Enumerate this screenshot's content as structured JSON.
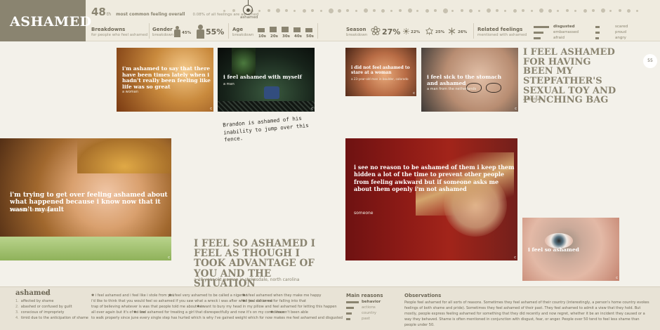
{
  "colors": {
    "accent": "#8a8470",
    "page_bg": "#f3f1ea",
    "topbar_bg": "#efebdf"
  },
  "header": {
    "title": "ASHAMED",
    "rank_number": "48",
    "rank_suffix": "th",
    "rank_label": "most common feeling overall",
    "rank_pct": "0.08% of all feelings are ashamed",
    "marker_label": "ashamed"
  },
  "breakdowns": {
    "title": "Breakdowns",
    "subtitle": "for people who feel ashamed",
    "gender": {
      "title": "Gender",
      "subtitle": "breakdown",
      "female_pct": "45%",
      "male_pct": "55%",
      "female_share": 0.45,
      "male_share": 0.55
    },
    "ages": {
      "title": "Age",
      "subtitle": "breakdown",
      "groups": [
        {
          "label": "10s",
          "share": 0.4
        },
        {
          "label": "20s",
          "share": 0.6
        },
        {
          "label": "30s",
          "share": 0.7
        },
        {
          "label": "40s",
          "share": 0.45
        },
        {
          "label": "50s",
          "share": 0.3
        }
      ]
    },
    "season": {
      "title": "Season",
      "subtitle": "breakdown",
      "spring": "27%",
      "summer": "22%",
      "fall": "25%",
      "winter": "26%"
    },
    "related": {
      "title": "Related feelings",
      "subtitle": "mentioned with ashamed",
      "col1": [
        "disgusted",
        "embarrassed",
        "afraid"
      ],
      "col2": [
        "scared",
        "proud",
        "angry"
      ]
    }
  },
  "photos": [
    {
      "caption": "i'm ashamed to say that there have been times lately when i hadn't really been feeling like life was so great",
      "attribution": "a woman"
    },
    {
      "caption": "i feel ashamed with myself",
      "attribution": "a man"
    },
    {
      "caption": "i did not feel ashamed to stare at a woman",
      "attribution": "a 23-year-old man in boulder, colorado"
    },
    {
      "caption": "i feel sick to the stomach and ashamed",
      "attribution": "a man from the netherlands"
    },
    {
      "caption": "i'm trying to get over feeling ashamed about what happened because i know now that it wasn't my fault",
      "attribution": "a woman in michigan"
    },
    {
      "caption": "i see no reason to be ashamed of them i keep them hidden a lot of the time to prevent other people from feeling awkward but if someone asks me about them openly i'm not ashamed",
      "attribution": "someone"
    },
    {
      "caption": "i feel so ashamed",
      "attribution": ""
    }
  ],
  "quotes": {
    "top_right": {
      "text": "I FEEL ASHAMED FOR HAVING BEEN MY STEPFATHER'S SEXUAL TOY AND PUNCHING BAG",
      "attribution": "a woman"
    },
    "center": {
      "text": "I FEEL SO ASHAMED I FEEL AS THOUGH I TOOK ADVANTAGE OF YOU AND THE SITUATION",
      "attribution": "a 28-year-old woman in stokesdale, north carolina"
    }
  },
  "handwritten_note": "Brandon is ashamed of his inability to jump over this fence.",
  "page_number": "55",
  "footer": {
    "definition": {
      "word": "ashamed",
      "pos": "adj.",
      "items": [
        "affected by shame",
        "abashed or confused by guilt",
        "conscious of impropriety",
        "timid due to the anticipation of shame"
      ]
    },
    "quotes": [
      "i feel ashamed and i feel like i stole from you",
      "i feel very ashamed to be called a nigerian",
      "i feel ashamed when they make me happy",
      "i'd like to think that you would feel so ashamed if you saw what a wreck i was after what you did to me",
      "i feel ashamed for falling into that",
      "trap of believing whatever is was that people told me about her",
      "i want to bury my head in my pillow and feel ashamed for letting this happen",
      "all over again but it's of no use",
      "i feel ashamed for treating a girl that disrespectfully and now it's on my conscience",
      "i haven't been able",
      "to walk properly since june every single step has hurted which is why i've gained weight which for now makes me feel ashamed and disgusted"
    ],
    "main_reasons": {
      "title": "Main reasons",
      "items": [
        {
          "label": "behavior",
          "share": 1.0
        },
        {
          "label": "actions",
          "share": 0.6
        },
        {
          "label": "country",
          "share": 0.45
        },
        {
          "label": "past",
          "share": 0.35
        }
      ]
    },
    "observations": {
      "title": "Observations",
      "text": "People feel ashamed for all sorts of reasons. Sometimes they feel ashamed of their country (interestingly, a person's home country evokes feelings of both shame and pride). Sometimes they feel ashamed of their past. They feel ashamed to admit a view that they hold. But mostly, people express feeling ashamed for something that they did recently and now regret, whether it be an incident they caused or a way they behaved. Shame is often mentioned in conjunction with disgust, fear, or anger. People over 50 tend to feel less shame than people under 50."
    }
  }
}
